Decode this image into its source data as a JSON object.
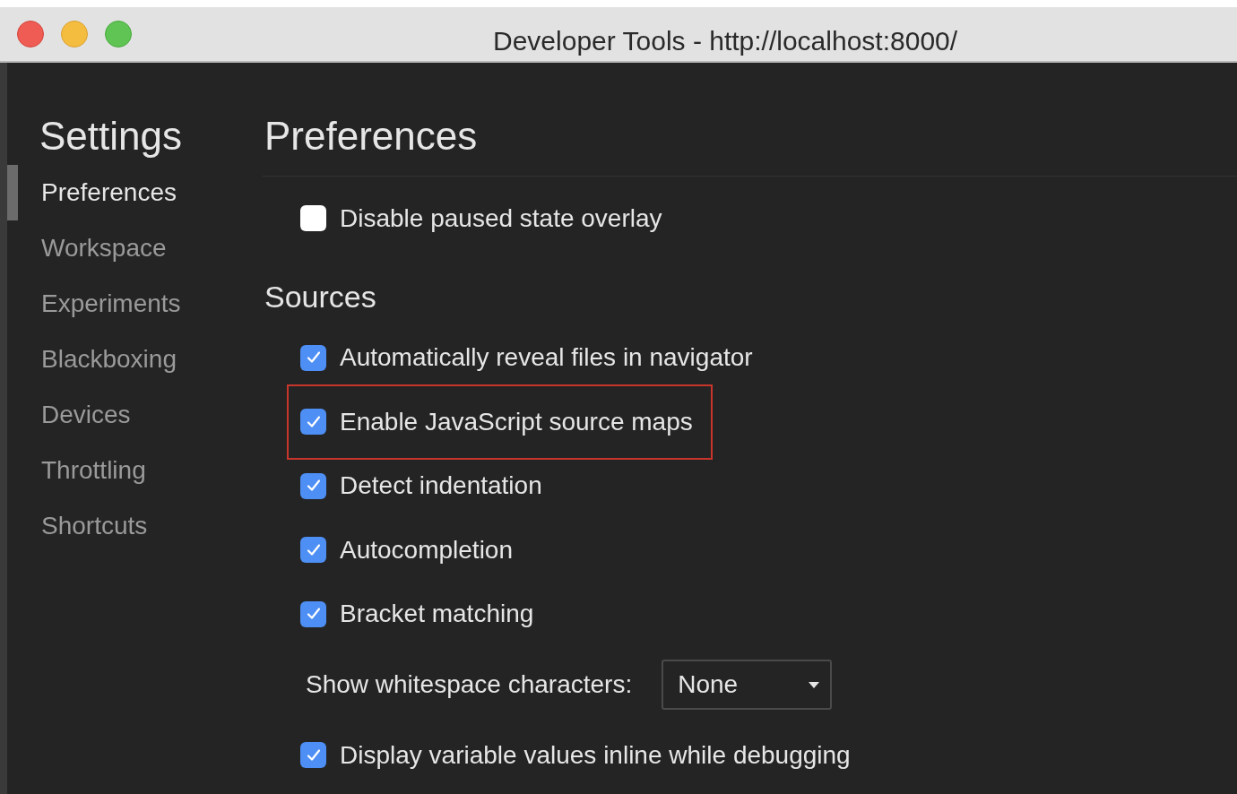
{
  "window": {
    "title": "Developer Tools - http://localhost:8000/"
  },
  "sidebar": {
    "title": "Settings",
    "items": [
      {
        "label": "Preferences",
        "selected": true
      },
      {
        "label": "Workspace",
        "selected": false
      },
      {
        "label": "Experiments",
        "selected": false
      },
      {
        "label": "Blackboxing",
        "selected": false
      },
      {
        "label": "Devices",
        "selected": false
      },
      {
        "label": "Throttling",
        "selected": false
      },
      {
        "label": "Shortcuts",
        "selected": false
      }
    ]
  },
  "main": {
    "title": "Preferences",
    "sections": [
      {
        "items": [
          {
            "kind": "checkbox",
            "label": "Disable paused state overlay",
            "checked": false,
            "highlighted": false
          }
        ]
      },
      {
        "title": "Sources",
        "items": [
          {
            "kind": "checkbox",
            "label": "Automatically reveal files in navigator",
            "checked": true,
            "highlighted": false
          },
          {
            "kind": "checkbox",
            "label": "Enable JavaScript source maps",
            "checked": true,
            "highlighted": true
          },
          {
            "kind": "checkbox",
            "label": "Detect indentation",
            "checked": true,
            "highlighted": false
          },
          {
            "kind": "checkbox",
            "label": "Autocompletion",
            "checked": true,
            "highlighted": false
          },
          {
            "kind": "checkbox",
            "label": "Bracket matching",
            "checked": true,
            "highlighted": false
          },
          {
            "kind": "select",
            "label": "Show whitespace characters:",
            "value": "None"
          },
          {
            "kind": "checkbox",
            "label": "Display variable values inline while debugging",
            "checked": true,
            "highlighted": false
          }
        ]
      }
    ]
  }
}
